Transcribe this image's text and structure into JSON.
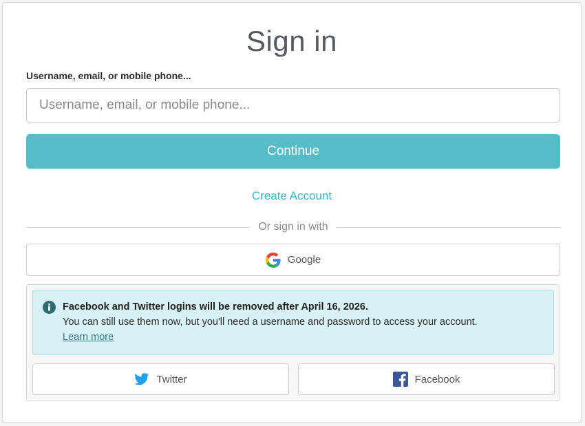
{
  "page": {
    "title": "Sign in"
  },
  "login": {
    "field_label": "Username, email, or mobile phone...",
    "field_placeholder": "Username, email, or mobile phone...",
    "field_value": "",
    "continue_label": "Continue",
    "create_account_label": "Create Account",
    "divider_text": "Or sign in with"
  },
  "social": {
    "google_label": "Google",
    "google_icon": "google-icon",
    "notice": {
      "icon": "info-icon",
      "title": "Facebook and Twitter logins will be removed after April 16, 2026.",
      "body": "You can still use them now, but you'll need a username and password to access your account.",
      "link_label": "Learn more"
    },
    "twitter_label": "Twitter",
    "twitter_icon": "twitter-icon",
    "facebook_label": "Facebook",
    "facebook_icon": "facebook-icon"
  },
  "colors": {
    "accent": "#56bcc7",
    "link": "#3db3c2",
    "notice_bg": "#d8f1f4",
    "info_icon": "#2f6b73",
    "twitter_blue": "#1da1f2",
    "facebook_blue": "#3b5998"
  }
}
